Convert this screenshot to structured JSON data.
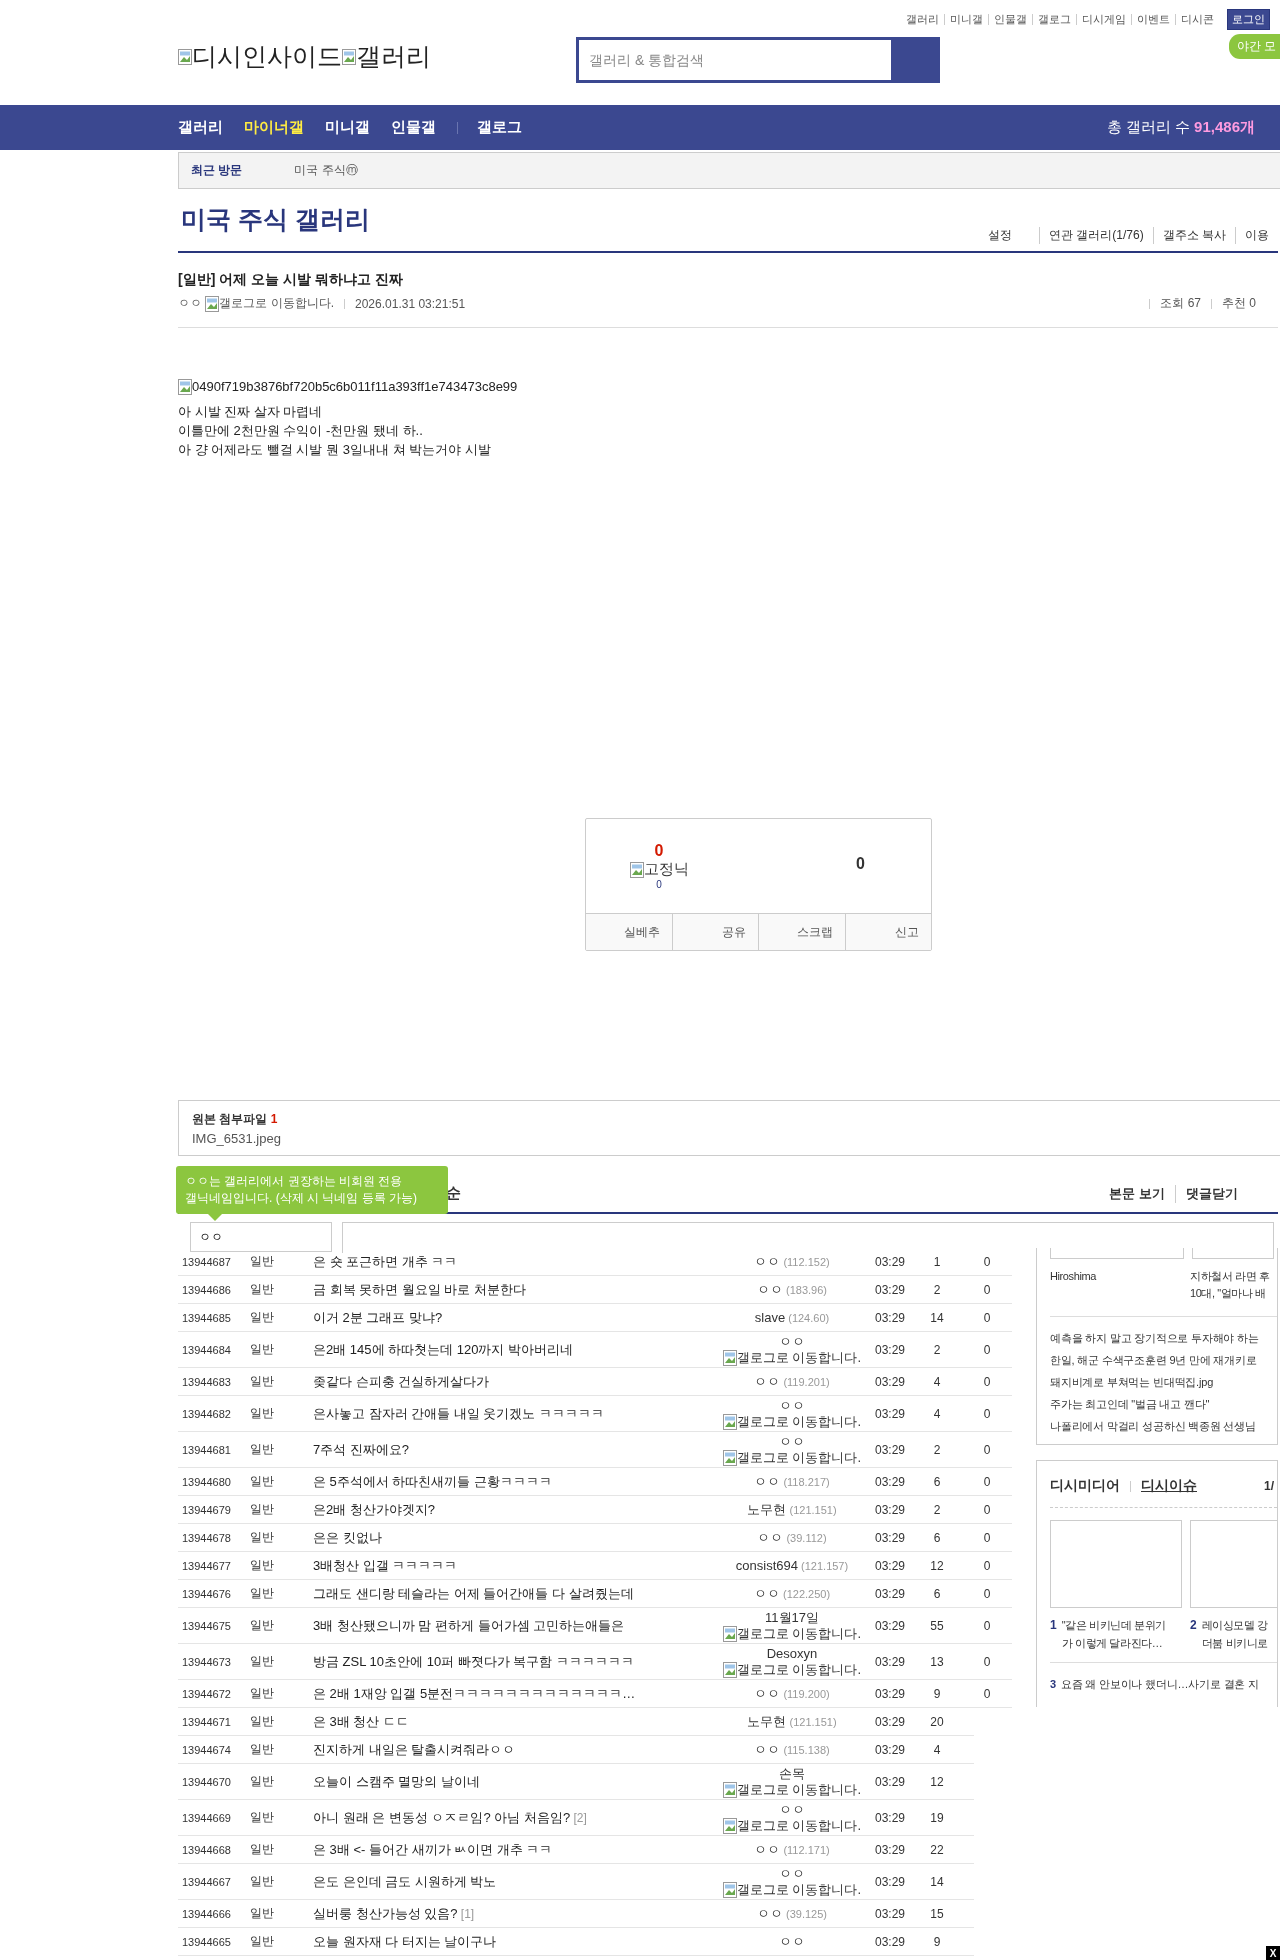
{
  "top_links": [
    "갤러리",
    "미니갤",
    "인물갤",
    "갤로그",
    "디시게임",
    "이벤트",
    "디시콘"
  ],
  "login_button": "로그인",
  "night_mode": "야간 모",
  "logo": [
    "디시인사이드",
    "갤러리"
  ],
  "search": {
    "placeholder": "갤러리 & 통합검색"
  },
  "nav": {
    "items": [
      {
        "label": "갤러리",
        "kind": "gallery",
        "selected": false
      },
      {
        "label": "마이너갤",
        "kind": "gallery",
        "selected": true
      },
      {
        "label": "미니갤",
        "kind": "gallery",
        "selected": false
      },
      {
        "label": "인물갤",
        "kind": "gallery",
        "selected": false
      },
      {
        "label": "갤로그",
        "kind": "link",
        "selected": false
      }
    ],
    "total_label": "총 갤러리 수",
    "total_count": "91,486개"
  },
  "recent": {
    "label": "최근 방문",
    "items": [
      {
        "name": "미국 주식",
        "badge": "ⓜ"
      }
    ]
  },
  "gallery": {
    "title": "미국 주식 갤러리",
    "links": [
      "설정",
      "연관 갤러리(1/76)",
      "갤주소 복사",
      "이용"
    ]
  },
  "post": {
    "title": "[일반] 어제 오늘 시발 뭐하냐고 진짜",
    "author": "ㅇㅇ",
    "gallog_alt": "갤로그로 이동합니다.",
    "date": "2026.01.31 03:21:51",
    "views": "조회 67",
    "recommends": "추천 0",
    "image_alt": "0490f719b3876bf720b5c6b011f11a393ff1e743473c8e99",
    "lines": [
      "아 시발 진짜 살자 마렵네",
      "이틀만에 2천만원 수익이 -천만원 됐네 하..",
      "아 걍 어제라도 뺄걸 시발 뭔 3일내내 쳐 박는거야 시발"
    ]
  },
  "vote": {
    "up": "0",
    "fixed_alt": "고정닉",
    "fixed_count": "0",
    "down": "0",
    "buttons": [
      "실베추",
      "공유",
      "스크랩",
      "신고"
    ]
  },
  "attachment": {
    "label": "원본 첨부파일",
    "count": "1",
    "file": "IMG_6531.jpeg"
  },
  "comments": {
    "sort_visible": "순",
    "links": [
      "본문 보기",
      "댓글닫기"
    ],
    "tooltip": [
      "ㅇㅇ는 갤러리에서 권장하는 비회원 전용",
      "갤닉네임입니다. (삭제 시 닉네임 등록 가능)"
    ],
    "nickname": "ㅇㅇ"
  },
  "list": [
    {
      "num": "13944687",
      "type": "일반",
      "title": "은 숏 포근하면 개추 ㅋㅋ",
      "writer": {
        "kind": "ip",
        "name": "ㅇㅇ",
        "ip": "(112.152)"
      },
      "date": "03:29",
      "views": "1",
      "recommends": "0"
    },
    {
      "num": "13944686",
      "type": "일반",
      "title": "금 회복 못하면 월요일 바로 처분한다",
      "writer": {
        "kind": "ip",
        "name": "ㅇㅇ",
        "ip": "(183.96)"
      },
      "date": "03:29",
      "views": "2",
      "recommends": "0"
    },
    {
      "num": "13944685",
      "type": "일반",
      "title": "이거 2분 그래프 맞냐?",
      "writer": {
        "kind": "ip",
        "name": "slave",
        "ip": "(124.60)"
      },
      "date": "03:29",
      "views": "14",
      "recommends": "0"
    },
    {
      "num": "13944684",
      "type": "일반",
      "title": "은2배 145에 하따쳣는데 120까지 박아버리네",
      "writer": {
        "kind": "gallog",
        "name": "ㅇㅇ",
        "gallog_alt": "갤로그로 이동합니다."
      },
      "date": "03:29",
      "views": "2",
      "recommends": "0"
    },
    {
      "num": "13944683",
      "type": "일반",
      "title": "좆같다 슨피충 건실하게살다가",
      "writer": {
        "kind": "ip",
        "name": "ㅇㅇ",
        "ip": "(119.201)"
      },
      "date": "03:29",
      "views": "4",
      "recommends": "0"
    },
    {
      "num": "13944682",
      "type": "일반",
      "title": "은사놓고 잠자러 간애들 내일 웃기겠노 ㅋㅋㅋㅋㅋ",
      "writer": {
        "kind": "gallog",
        "name": "ㅇㅇ",
        "gallog_alt": "갤로그로 이동합니다."
      },
      "date": "03:29",
      "views": "4",
      "recommends": "0"
    },
    {
      "num": "13944681",
      "type": "일반",
      "title": "7주석 진짜에요?",
      "writer": {
        "kind": "gallog",
        "name": "ㅇㅇ",
        "gallog_alt": "갤로그로 이동합니다."
      },
      "date": "03:29",
      "views": "2",
      "recommends": "0"
    },
    {
      "num": "13944680",
      "type": "일반",
      "title": "은 5주석에서 하따친새끼들 근황ㅋㅋㅋㅋ",
      "writer": {
        "kind": "ip",
        "name": "ㅇㅇ",
        "ip": "(118.217)"
      },
      "date": "03:29",
      "views": "6",
      "recommends": "0"
    },
    {
      "num": "13944679",
      "type": "일반",
      "title": "은2배 청산가야겟지?",
      "writer": {
        "kind": "ip",
        "name": "노무현",
        "ip": "(121.151)"
      },
      "date": "03:29",
      "views": "2",
      "recommends": "0"
    },
    {
      "num": "13944678",
      "type": "일반",
      "title": "은은 킷없나",
      "writer": {
        "kind": "ip",
        "name": "ㅇㅇ",
        "ip": "(39.112)"
      },
      "date": "03:29",
      "views": "6",
      "recommends": "0"
    },
    {
      "num": "13944677",
      "type": "일반",
      "title": "3배청산 입갤 ㅋㅋㅋㅋㅋ",
      "writer": {
        "kind": "ip",
        "name": "consist694",
        "ip": "(121.157)"
      },
      "date": "03:29",
      "views": "12",
      "recommends": "0"
    },
    {
      "num": "13944676",
      "type": "일반",
      "title": "그래도 샌디랑 테슬라는 어제 들어간애들 다 살려줬는데",
      "writer": {
        "kind": "ip",
        "name": "ㅇㅇ",
        "ip": "(122.250)"
      },
      "date": "03:29",
      "views": "6",
      "recommends": "0"
    },
    {
      "num": "13944675",
      "type": "일반",
      "title": "3배 청산됐으니까 맘 편하게 들어가셈 고민하는애들은",
      "writer": {
        "kind": "gallog",
        "name": "11월17일",
        "gallog_alt": "갤로그로 이동합니다."
      },
      "date": "03:29",
      "views": "55",
      "recommends": "0"
    },
    {
      "num": "13944673",
      "type": "일반",
      "title": "방금 ZSL 10초안에 10퍼 빠졋다가 복구함 ㅋㅋㅋㅋㅋㅋ",
      "writer": {
        "kind": "gallog",
        "name": "Desoxyn",
        "gallog_alt": "갤로그로 이동합니다."
      },
      "date": "03:29",
      "views": "13",
      "recommends": "0"
    },
    {
      "num": "13944672",
      "type": "일반",
      "title": "은 2배 1재앙 입갤 5분전ㅋㅋㅋㅋㅋㅋㅋㅋㅋㅋㅋㅋㅋ…",
      "writer": {
        "kind": "ip",
        "name": "ㅇㅇ",
        "ip": "(119.200)"
      },
      "date": "03:29",
      "views": "9",
      "recommends": "0"
    },
    {
      "num": "13944671",
      "type": "일반",
      "title": "은 3배 청산 ㄷㄷ",
      "writer": {
        "kind": "ip",
        "name": "노무현",
        "ip": "(121.151)"
      },
      "date": "03:29",
      "views": "20"
    },
    {
      "num": "13944674",
      "type": "일반",
      "title": "진지하게 내일은 탈출시켜줘라ㅇㅇ",
      "writer": {
        "kind": "ip",
        "name": "ㅇㅇ",
        "ip": "(115.138)"
      },
      "date": "03:29",
      "views": "4"
    },
    {
      "num": "13944670",
      "type": "일반",
      "title": "오늘이 스캠주 멸망의 날이네",
      "writer": {
        "kind": "gallog",
        "name": "손목",
        "gallog_alt": "갤로그로 이동합니다."
      },
      "date": "03:29",
      "views": "12"
    },
    {
      "num": "13944669",
      "type": "일반",
      "title": "아니 원래 은 변동성 ㅇㅈㄹ임? 아님 처음임?",
      "reply_count": "[2]",
      "writer": {
        "kind": "gallog",
        "name": "ㅇㅇ",
        "gallog_alt": "갤로그로 이동합니다."
      },
      "date": "03:29",
      "views": "19"
    },
    {
      "num": "13944668",
      "type": "일반",
      "title": "은 3배 <- 들어간 새끼가 ㅄ이면 개추 ㅋㅋ",
      "writer": {
        "kind": "ip",
        "name": "ㅇㅇ",
        "ip": "(112.171)"
      },
      "date": "03:29",
      "views": "22"
    },
    {
      "num": "13944667",
      "type": "일반",
      "title": "은도 은인데 금도 시원하게 박노",
      "writer": {
        "kind": "gallog",
        "name": "ㅇㅇ",
        "gallog_alt": "갤로그로 이동합니다."
      },
      "date": "03:29",
      "views": "14"
    },
    {
      "num": "13944666",
      "type": "일반",
      "title": "실버룽 청산가능성 있음?",
      "reply_count": "[1]",
      "writer": {
        "kind": "ip",
        "name": "ㅇㅇ",
        "ip": "(39.125)"
      },
      "date": "03:29",
      "views": "15"
    },
    {
      "num": "13944665",
      "type": "일반",
      "title": "오늘 원자재 다 터지는 날이구나",
      "writer": {
        "kind": "name",
        "name": "ㅇㅇ"
      },
      "date": "03:29",
      "views": "9"
    }
  ],
  "sidebar": {
    "top_captions": [
      [
        "Hiroshima"
      ],
      [
        "지하철서 라면 후",
        "10대, \"얼마나 배"
      ]
    ],
    "news": [
      "예측을 하지 말고 장기적으로 투자해야 하는",
      "한일, 해군 수색구조훈련 9년 만에 재개키로",
      "돼지비계로 부쳐먹는 빈대떡집.jpg",
      "주가는 최고인데 \"벌금 내고 깬다\"",
      "나폴리에서 막걸리 성공하신 백종원 선생님"
    ],
    "media_tabs": [
      {
        "label": "디시미디어",
        "selected": false
      },
      {
        "label": "디시이슈",
        "selected": true
      }
    ],
    "page": "1/",
    "cards": [
      {
        "rank": "1",
        "lines": [
          "\"같은 비키닌데 분위기",
          "가 이렇게 달라진다…"
        ]
      },
      {
        "rank": "2",
        "lines": [
          "레이싱모델 강",
          "더붐 비키니로"
        ]
      }
    ],
    "more": [
      {
        "rank": "3",
        "text": "요즘 왜 안보이나 했더니…사기로 결혼 지"
      }
    ]
  },
  "close_label": "X"
}
